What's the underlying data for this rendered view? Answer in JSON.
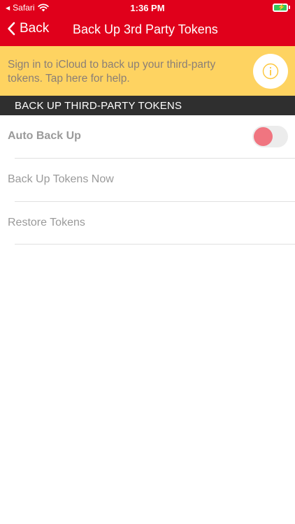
{
  "status_bar": {
    "back_app": "Safari",
    "time": "1:36 PM"
  },
  "nav": {
    "back_label": "Back",
    "title": "Back Up 3rd Party Tokens"
  },
  "banner": {
    "text": "Sign in to iCloud to back up your third-party tokens. Tap here for help.",
    "icon": "info-icon"
  },
  "section": {
    "header": "BACK UP THIRD-PARTY TOKENS"
  },
  "rows": {
    "auto_backup": {
      "label": "Auto Back Up",
      "toggle_on": false
    },
    "backup_now": {
      "label": "Back Up Tokens Now"
    },
    "restore": {
      "label": "Restore Tokens"
    }
  },
  "colors": {
    "nav_red": "#e0001b",
    "banner_yellow": "#fed361",
    "section_dark": "#2f2f2f",
    "toggle_knob": "#f07580",
    "battery_green": "#34c759"
  }
}
